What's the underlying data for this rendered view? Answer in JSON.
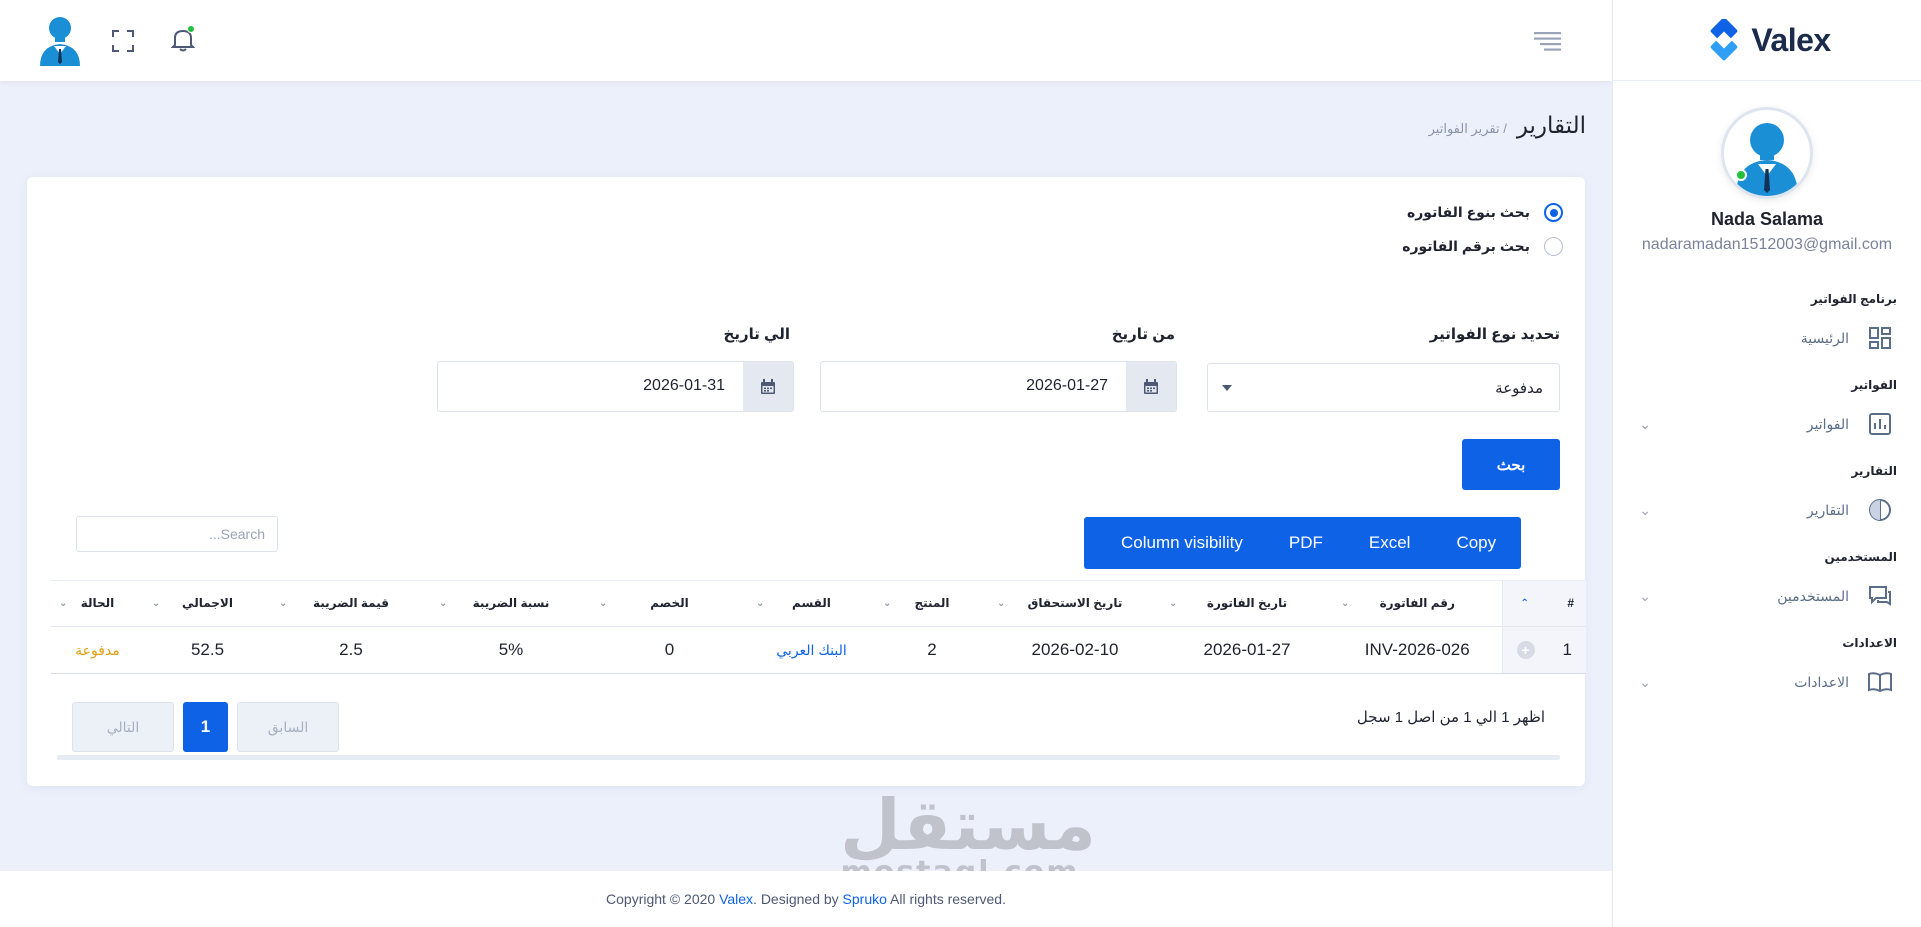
{
  "brand": {
    "name": "Valex",
    "accent": "#0d62e6"
  },
  "profile": {
    "name": "Nada Salama",
    "email": "nadaramadan1512003@gmail.com"
  },
  "sidebar": {
    "sections": [
      {
        "category": "برنامج الفواتير",
        "item": "الرئيسية",
        "icon": "dashboard-icon",
        "has_chevron": false
      },
      {
        "category": "الفواتير",
        "item": "الفواتير",
        "icon": "bar-chart-icon",
        "has_chevron": true
      },
      {
        "category": "التقارير",
        "item": "التقارير",
        "icon": "pie-chart-icon",
        "has_chevron": true
      },
      {
        "category": "المستخدمين",
        "item": "المستخدمين",
        "icon": "chat-icon",
        "has_chevron": true
      },
      {
        "category": "الاعدادات",
        "item": "الاعدادات",
        "icon": "book-icon",
        "has_chevron": true
      }
    ]
  },
  "header": {
    "icons": [
      "avatar-icon",
      "fullscreen-icon",
      "bell-icon",
      "menu-icon"
    ]
  },
  "breadcrumb": {
    "title": "التقارير",
    "sub": "/ تقرير الفواتير"
  },
  "filters": {
    "radio_type": "بحث بنوع الفاتوره",
    "radio_number": "بحث برقم الفاتوره",
    "type_label": "تحديد نوع الفواتير",
    "type_value": "مدفوعة",
    "from_label": "من تاريخ",
    "from_value": "2026-01-27",
    "to_label": "الي تاريخ",
    "to_value": "2026-01-31",
    "search_button": "بحث"
  },
  "export_buttons": {
    "copy": "Copy",
    "excel": "Excel",
    "pdf": "PDF",
    "colvis": "Column visibility"
  },
  "search": {
    "placeholder": "Search..."
  },
  "table": {
    "headers": [
      "#",
      "رقم الفاتورة",
      "تاريخ الفاتورة",
      "تاريخ الاستحقاق",
      "المنتج",
      "القسم",
      "الخصم",
      "نسبة الضريبة",
      "قيمة الضريبة",
      "الاجمالي",
      "الحالة"
    ],
    "rows": [
      [
        "1",
        "INV-2026-026",
        "2026-01-27",
        "2026-02-10",
        "2",
        "البنك العربي",
        "0",
        "5%",
        "2.5",
        "52.5",
        "مدفوعة"
      ]
    ]
  },
  "pagination": {
    "info": "اظهر 1 الي 1 من اصل 1 سجل",
    "prev": "السابق",
    "page": "1",
    "next": "التالي"
  },
  "footer": {
    "prefix": "Copyright © 2020 ",
    "brand": "Valex",
    "mid": ". Designed by ",
    "designer": "Spruko",
    "suffix": " All rights reserved."
  },
  "watermark": {
    "ar": "مستقل",
    "en": "mostaql.com"
  }
}
